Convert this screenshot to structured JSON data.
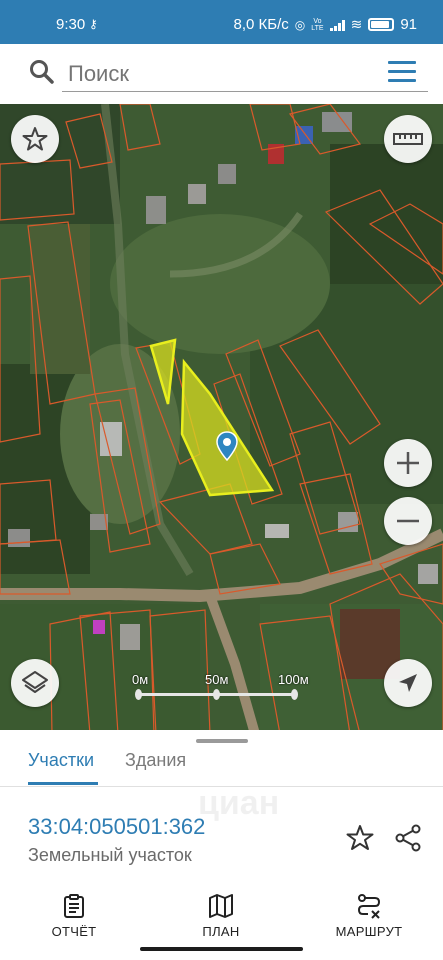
{
  "status_bar": {
    "time": "9:30",
    "net_speed": "8,0 КБ/с",
    "volte": "Vo LTE",
    "battery": "91"
  },
  "search": {
    "placeholder": "Поиск"
  },
  "map": {
    "scale_labels": [
      "0м",
      "50м",
      "100м"
    ],
    "colors": {
      "parcel_outline": "#d95a2b",
      "selected_fill": "#d9dd22",
      "marker": "#2e86c1"
    }
  },
  "sheet": {
    "tabs": [
      "Участки",
      "Здания"
    ],
    "active_tab": "Участки",
    "cadastral_number": "33:04:050501:362",
    "parcel_type": "Земельный участок",
    "watermark": "циан"
  },
  "bottom_nav": {
    "items": [
      "ОТЧЁТ",
      "ПЛАН",
      "МАРШРУТ"
    ]
  },
  "colors": {
    "accent": "#2e7db3"
  }
}
